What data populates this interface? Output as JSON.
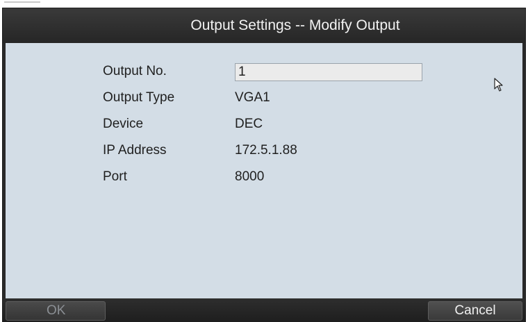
{
  "dialog": {
    "title": "Output Settings -- Modify Output"
  },
  "form": {
    "output_no": {
      "label": "Output No.",
      "value": "1"
    },
    "output_type": {
      "label": "Output Type",
      "value": "VGA1"
    },
    "device": {
      "label": "Device",
      "value": "DEC"
    },
    "ip_address": {
      "label": "IP Address",
      "value": "172.5.1.88"
    },
    "port": {
      "label": "Port",
      "value": "8000"
    }
  },
  "footer": {
    "ok_label": "OK",
    "ok_enabled": false,
    "cancel_label": "Cancel"
  },
  "icons": {
    "cursor": "mouse-pointer-icon"
  },
  "colors": {
    "panel_bg": "#d3dde6",
    "title_bg": "#2a2a2a",
    "title_text": "#f2f2f2",
    "disabled_text": "#8b8f94"
  }
}
